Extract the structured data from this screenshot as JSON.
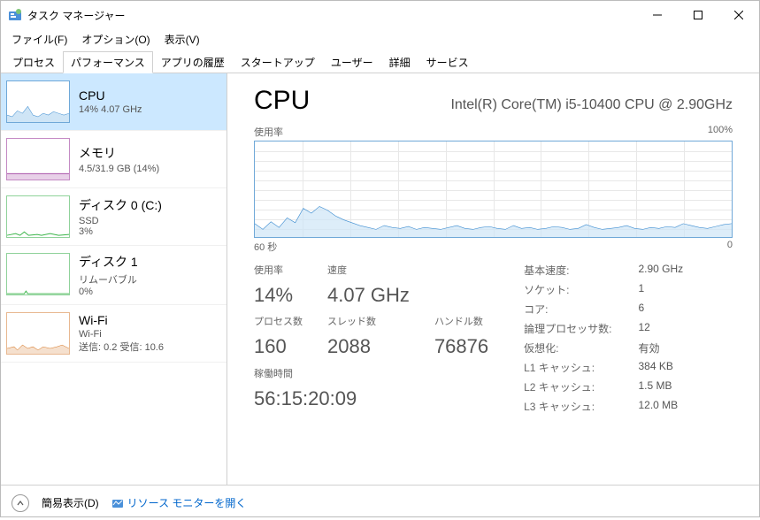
{
  "window": {
    "title": "タスク マネージャー"
  },
  "menus": {
    "file": "ファイル(F)",
    "options": "オプション(O)",
    "view": "表示(V)"
  },
  "tabs": {
    "processes": "プロセス",
    "performance": "パフォーマンス",
    "app_history": "アプリの履歴",
    "startup": "スタートアップ",
    "users": "ユーザー",
    "details": "詳細",
    "services": "サービス"
  },
  "sidebar": {
    "items": [
      {
        "name": "CPU",
        "sub": "14%  4.07 GHz",
        "color": "#3a8bd0"
      },
      {
        "name": "メモリ",
        "sub": "4.5/31.9 GB (14%)",
        "color": "#a040a0"
      },
      {
        "name": "ディスク 0 (C:)",
        "sub": "SSD",
        "sub2": "3%",
        "color": "#3bb54a"
      },
      {
        "name": "ディスク 1",
        "sub": "リムーバブル",
        "sub2": "0%",
        "color": "#3bb54a"
      },
      {
        "name": "Wi-Fi",
        "sub": "Wi-Fi",
        "sub2": "送信: 0.2  受信: 10.6",
        "color": "#d87a2a"
      }
    ]
  },
  "detail": {
    "title": "CPU",
    "model": "Intel(R) Core(TM) i5-10400 CPU @ 2.90GHz",
    "chart_top_left": "使用率",
    "chart_top_right": "100%",
    "chart_bottom_left": "60 秒",
    "chart_bottom_right": "0",
    "stats_left": {
      "usage_lbl": "使用率",
      "usage_val": "14%",
      "speed_lbl": "速度",
      "speed_val": "4.07 GHz",
      "proc_lbl": "プロセス数",
      "proc_val": "160",
      "threads_lbl": "スレッド数",
      "threads_val": "2088",
      "handles_lbl": "ハンドル数",
      "handles_val": "76876",
      "uptime_lbl": "稼働時間",
      "uptime_val": "56:15:20:09"
    },
    "stats_right": {
      "base_speed_lbl": "基本速度:",
      "base_speed_val": "2.90 GHz",
      "sockets_lbl": "ソケット:",
      "sockets_val": "1",
      "cores_lbl": "コア:",
      "cores_val": "6",
      "logical_lbl": "論理プロセッサ数:",
      "logical_val": "12",
      "virt_lbl": "仮想化:",
      "virt_val": "有効",
      "l1_lbl": "L1 キャッシュ:",
      "l1_val": "384 KB",
      "l2_lbl": "L2 キャッシュ:",
      "l2_val": "1.5 MB",
      "l3_lbl": "L3 キャッシュ:",
      "l3_val": "12.0 MB"
    }
  },
  "footer": {
    "fewer": "簡易表示(D)",
    "resmon": "リソース モニターを開く"
  },
  "chart_data": {
    "type": "area",
    "title": "CPU 使用率",
    "xlabel": "秒",
    "ylabel": "%",
    "ylim": [
      0,
      100
    ],
    "x_range_seconds": [
      60,
      0
    ],
    "values": [
      14,
      8,
      16,
      10,
      20,
      15,
      30,
      25,
      32,
      28,
      22,
      18,
      15,
      12,
      10,
      8,
      12,
      10,
      9,
      11,
      8,
      10,
      9,
      8,
      10,
      12,
      9,
      8,
      10,
      11,
      9,
      8,
      12,
      9,
      10,
      8,
      9,
      11,
      10,
      8,
      9,
      13,
      10,
      8,
      9,
      10,
      12,
      9,
      8,
      10,
      9,
      11,
      10,
      14,
      12,
      10,
      9,
      11,
      13,
      14
    ]
  }
}
